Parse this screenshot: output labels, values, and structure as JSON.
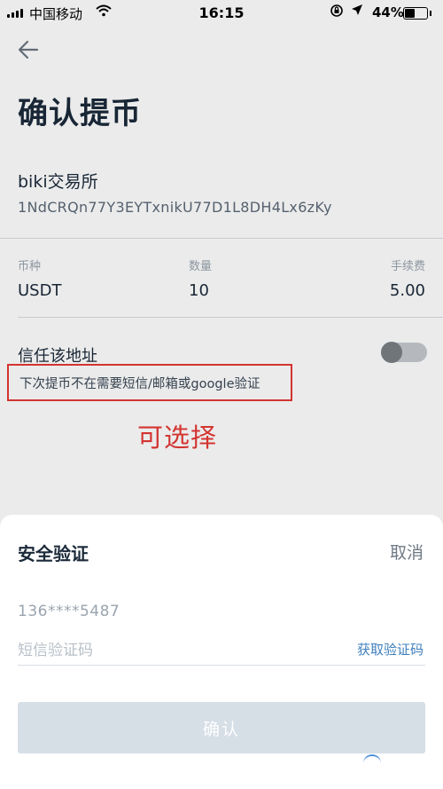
{
  "status_bar": {
    "carrier": "中国移动",
    "time": "16:15",
    "battery": "44%"
  },
  "header": {
    "title": "确认提币"
  },
  "withdraw": {
    "exchange_name": "biki交易所",
    "address": "1NdCRQn77Y3EYTxnikU77D1L8DH4Lx6zKy",
    "columns": [
      {
        "label": "币种",
        "value": "USDT"
      },
      {
        "label": "数量",
        "value": "10"
      },
      {
        "label": "手续费",
        "value": "5.00"
      }
    ],
    "trust_label": "信任该地址",
    "trust_enabled": false,
    "trust_hint": "下次提币不在需要短信/邮箱或google验证"
  },
  "annotation": "可选择",
  "security_sheet": {
    "title": "安全验证",
    "cancel_label": "取消",
    "phone_masked": "136****5487",
    "code_placeholder": "短信验证码",
    "get_code_label": "获取验证码",
    "confirm_label": "确认"
  },
  "colors": {
    "accent_link": "#3f7fbd",
    "annotation_red": "#e53935",
    "disabled_button": "#d6dee6"
  }
}
